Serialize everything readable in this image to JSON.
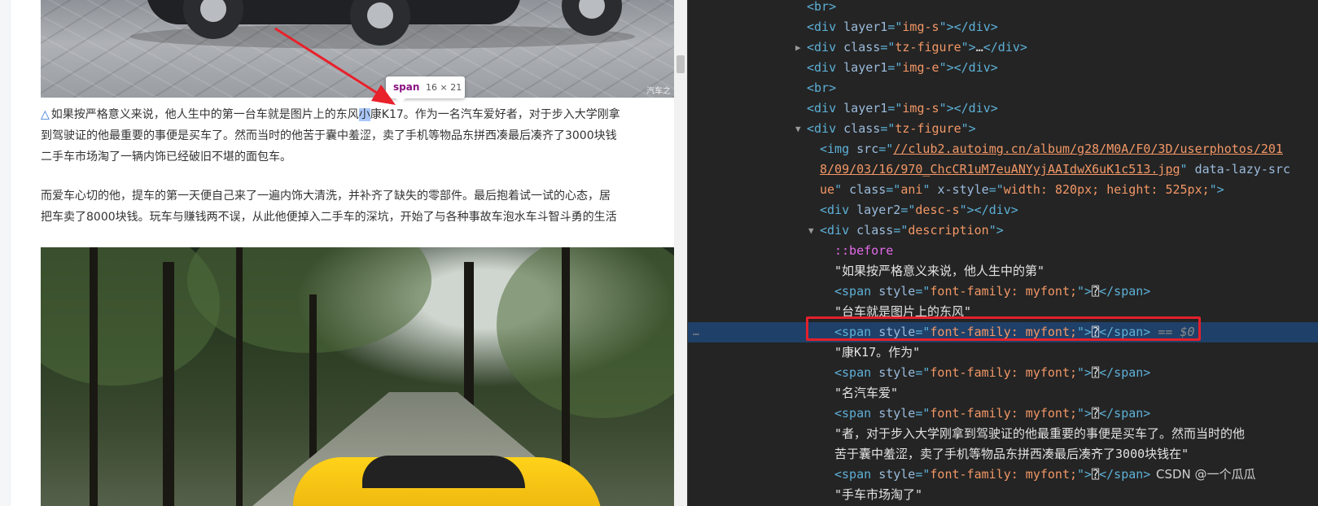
{
  "article": {
    "photo1_watermark": "汽车之",
    "para1": [
      {
        "prefix": "△",
        "before": "如果按严格意义来说，他人生中的第一台车就是图片上的东风",
        "highlight": "小",
        "after": "康K17。作为一名汽车爱好者，对于步入大学刚拿"
      },
      {
        "text": "到驾驶证的他最重要的事便是买车了。然而当时的他苦于囊中羞涩，卖了手机等物品东拼西凑最后凑齐了3000块钱"
      },
      {
        "text": "二手车市场淘了一辆内饰已经破旧不堪的面包车。"
      }
    ],
    "para2": [
      "而爱车心切的他，提车的第一天便自己来了一遍内饰大清洗，并补齐了缺失的零部件。最后抱着试一试的心态，居",
      "把车卖了8000块钱。玩车与赚钱两不误，从此他便掉入二手车的深坑，开始了与各种事故车泡水车斗智斗勇的生活"
    ]
  },
  "tooltip": {
    "tag": "span",
    "dims": "16 × 21"
  },
  "devtools": {
    "lines": [
      {
        "indent": 990,
        "twisty": "",
        "html": "<span class=\"t\">&lt;br&gt;</span>"
      },
      {
        "indent": 990,
        "twisty": "",
        "html": "<span class=\"t\">&lt;div </span><span class=\"an\">layer1</span><span class=\"t\">=\"</span><span class=\"av\">img-s</span><span class=\"t\">\"&gt;&lt;/div&gt;</span>"
      },
      {
        "indent": 990,
        "twisty": "▶",
        "html": "<span class=\"t\">&lt;div </span><span class=\"an\">class</span><span class=\"t\">=\"</span><span class=\"av\">tz-figure</span><span class=\"t\">\"&gt;</span><span class=\"tx\">…</span><span class=\"t\">&lt;/div&gt;</span>"
      },
      {
        "indent": 990,
        "twisty": "",
        "html": "<span class=\"t\">&lt;div </span><span class=\"an\">layer1</span><span class=\"t\">=\"</span><span class=\"av\">img-e</span><span class=\"t\">\"&gt;&lt;/div&gt;</span>"
      },
      {
        "indent": 990,
        "twisty": "",
        "html": "<span class=\"t\">&lt;br&gt;</span>"
      },
      {
        "indent": 990,
        "twisty": "",
        "html": "<span class=\"t\">&lt;div </span><span class=\"an\">layer1</span><span class=\"t\">=\"</span><span class=\"av\">img-s</span><span class=\"t\">\"&gt;&lt;/div&gt;</span>"
      },
      {
        "indent": 990,
        "twisty": "▼",
        "html": "<span class=\"t\">&lt;div </span><span class=\"an\">class</span><span class=\"t\">=\"</span><span class=\"av\">tz-figure</span><span class=\"t\">\"&gt;</span>"
      },
      {
        "indent": 1006,
        "twisty": "",
        "html": "<span class=\"t\">&lt;img </span><span class=\"an\">src</span><span class=\"t\">=\"</span><span class=\"lk\">//club2.autoimg.cn/album/g28/M0A/F0/3D/userphotos/201</span>"
      },
      {
        "indent": 1006,
        "twisty": "",
        "html": "<span class=\"lk\">8/09/03/16/970_ChcCR1uM7euANYyjAAIdwX6uK1c513.jpg</span><span class=\"t\">\" </span><span class=\"an\">data-lazy-src</span>"
      },
      {
        "indent": 1006,
        "twisty": "",
        "html": "<span class=\"av\">ue</span><span class=\"t\">\" </span><span class=\"an\">class</span><span class=\"t\">=\"</span><span class=\"av\">ani</span><span class=\"t\">\" </span><span class=\"an\">x-style</span><span class=\"t\">=\"</span><span class=\"av\">width: 820px; height: 525px;</span><span class=\"t\">\"&gt;</span>"
      },
      {
        "indent": 1006,
        "twisty": "",
        "html": "<span class=\"t\">&lt;div </span><span class=\"an\">layer2</span><span class=\"t\">=\"</span><span class=\"av\">desc-s</span><span class=\"t\">\"&gt;&lt;/div&gt;</span>"
      },
      {
        "indent": 1006,
        "twisty": "▼",
        "html": "<span class=\"t\">&lt;div </span><span class=\"an\">class</span><span class=\"t\">=\"</span><span class=\"av\">description</span><span class=\"t\">\"&gt;</span>"
      },
      {
        "indent": 1024,
        "twisty": "",
        "html": "<span class=\"ps\">::before</span>"
      },
      {
        "indent": 1024,
        "twisty": "",
        "html": "<span class=\"tx\">\"如果按严格意义来说，他人生中的第\"</span>"
      },
      {
        "indent": 1024,
        "twisty": "",
        "html": "<span class=\"t\">&lt;span </span><span class=\"an\">style</span><span class=\"t\">=\"</span><span class=\"av\">font-family: myfont;</span><span class=\"t\">\"&gt;</span><span class=\"tx\">⍰</span><span class=\"t\">&lt;/span&gt;</span>"
      },
      {
        "indent": 1024,
        "twisty": "",
        "html": "<span class=\"tx\">\"台车就是图片上的东风\"</span>"
      },
      {
        "indent": 1024,
        "twisty": "",
        "selected": true,
        "html": "<span class=\"t\">&lt;span </span><span class=\"an\">style</span><span class=\"t\">=\"</span><span class=\"av\">font-family: myfont;</span><span class=\"t\">\"&gt;</span><span class=\"tx\">⍰</span><span class=\"t\">&lt;/span&gt;</span><span class=\"dim\"> == $0</span>"
      },
      {
        "indent": 1024,
        "twisty": "",
        "html": "<span class=\"tx\">\"康K17。作为\"</span>"
      },
      {
        "indent": 1024,
        "twisty": "",
        "html": "<span class=\"t\">&lt;span </span><span class=\"an\">style</span><span class=\"t\">=\"</span><span class=\"av\">font-family: myfont;</span><span class=\"t\">\"&gt;</span><span class=\"tx\">⍰</span><span class=\"t\">&lt;/span&gt;</span>"
      },
      {
        "indent": 1024,
        "twisty": "",
        "html": "<span class=\"tx\">\"名汽车爱\"</span>"
      },
      {
        "indent": 1024,
        "twisty": "",
        "html": "<span class=\"t\">&lt;span </span><span class=\"an\">style</span><span class=\"t\">=\"</span><span class=\"av\">font-family: myfont;</span><span class=\"t\">\"&gt;</span><span class=\"tx\">⍰</span><span class=\"t\">&lt;/span&gt;</span>"
      },
      {
        "indent": 1024,
        "twisty": "",
        "html": "<span class=\"tx\">\"者，对于步入大学刚拿到驾驶证的他最重要的事便是买车了。然而当时的他</span>"
      },
      {
        "indent": 1024,
        "twisty": "",
        "html": "<span class=\"tx\">苦于囊中羞涩，卖了手机等物品东拼西凑最后凑齐了3000块钱在\"</span>"
      },
      {
        "indent": 1024,
        "twisty": "",
        "html": "<span class=\"t\">&lt;span </span><span class=\"an\">style</span><span class=\"t\">=\"</span><span class=\"av\">font-family: myfont;</span><span class=\"t\">\"&gt;</span><span class=\"tx\">⍰</span><span class=\"t\">&lt;/span&gt;</span>"
      },
      {
        "indent": 1024,
        "twisty": "",
        "html": "<span class=\"tx\">\"手车市场淘了\"</span>"
      }
    ],
    "dots": "…",
    "watermark": "CSDN @一个瓜瓜"
  },
  "colors": {
    "highlight": "#a8c7fa",
    "selection": "#1f4068",
    "redbox": "#e3202c",
    "arrow": "#e8212b"
  }
}
